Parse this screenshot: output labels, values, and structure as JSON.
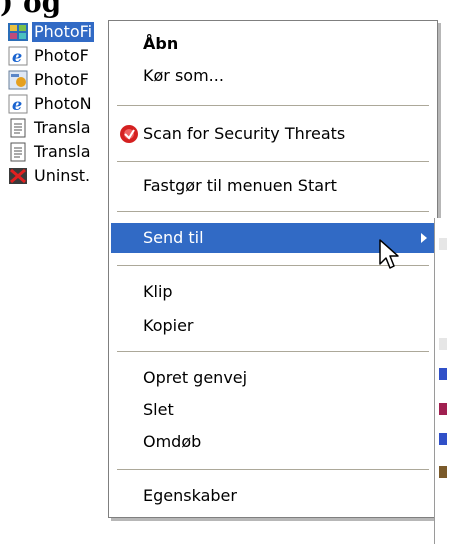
{
  "heading_fragment": ") og",
  "files": [
    {
      "label": "PhotoFi",
      "icon": "video-file-icon",
      "selected": true
    },
    {
      "label": "PhotoF",
      "icon": "internet-explorer-icon",
      "selected": false
    },
    {
      "label": "PhotoF",
      "icon": "setup-icon",
      "selected": false
    },
    {
      "label": "PhotoN",
      "icon": "internet-explorer-icon",
      "selected": false
    },
    {
      "label": "Transla",
      "icon": "text-document-icon",
      "selected": false
    },
    {
      "label": "Transla",
      "icon": "text-document-icon",
      "selected": false
    },
    {
      "label": "Uninst.",
      "icon": "uninstall-icon",
      "selected": false
    }
  ],
  "menu": {
    "open": "Åbn",
    "run_as": "Kør som...",
    "scan": "Scan for Security Threats",
    "pin_start": "Fastgør til menuen Start",
    "send_to": "Send til",
    "cut": "Klip",
    "copy": "Kopier",
    "create_shortcut": "Opret genvej",
    "delete": "Slet",
    "rename": "Omdøb",
    "properties": "Egenskaber"
  },
  "colors": {
    "selection": "#316ac5",
    "menu_border": "#7f7f7f",
    "separator": "#aca899"
  }
}
